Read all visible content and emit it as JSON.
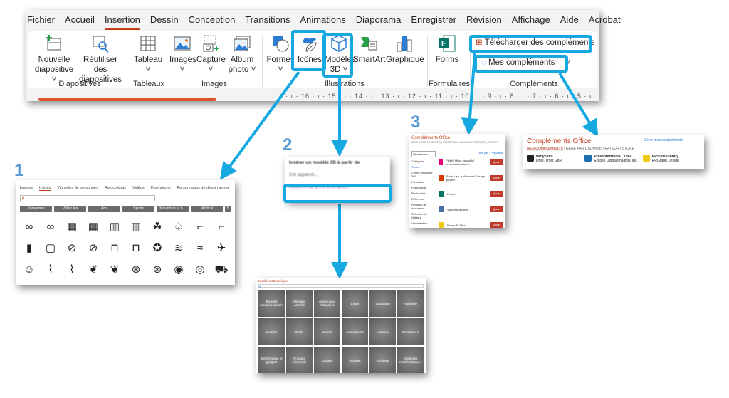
{
  "ribbon": {
    "tabs": [
      "Fichier",
      "Accueil",
      "Insertion",
      "Dessin",
      "Conception",
      "Transitions",
      "Animations",
      "Diaporama",
      "Enregistrer",
      "Révision",
      "Affichage",
      "Aide",
      "Acrobat"
    ],
    "active_tab": "Insertion",
    "buttons": {
      "nouvelle": "Nouvelle diapositive ˅",
      "reutiliser": "Réutiliser des diapositives",
      "tableau": "Tableau ˅",
      "images": "Images ˅",
      "capture": "Capture ˅",
      "album": "Album photo ˅",
      "formes": "Formes ˅",
      "icones": "Icônes",
      "modeles": "Modèles 3D ˅",
      "smartart": "SmartArt",
      "graphique": "Graphique",
      "forms": "Forms",
      "telecharger": "Télécharger des compléments",
      "mes": "Mes compléments",
      "mes_chevron": "˅"
    },
    "groups": [
      "Diapositives",
      "Tableaux",
      "Images",
      "Illustrations",
      "Formulaires",
      "Compléments"
    ],
    "ruler": "· ı · 16 · ı · 15 · ı · 14 · ı · 13 · ı · 12 · ı · 11 · ı · 10 · ı · 9 · ı · 8 · ı · 7 · ı · 6 · ı · 5 · ı"
  },
  "accent": "#16a9e1",
  "steps": [
    "1",
    "2",
    "3"
  ],
  "icons_panel": {
    "tabs": [
      "Images",
      "Icônes",
      "Vignettes de personnes",
      "Autocollants",
      "Vidéos",
      "Illustrations",
      "Personnages de dessin animé"
    ],
    "active_tab": "Icônes",
    "search_icon": "ρ",
    "categories": [
      "Personnes",
      "Véhicules",
      "Arts",
      "Sports",
      "Nourriture et b...",
      "Médical",
      "S"
    ],
    "icons": [
      "∞",
      "∞",
      "▦",
      "▦",
      "▥",
      "▥",
      "☘",
      "♤",
      "⌐",
      "⌐",
      "▮",
      "▢",
      "⊘",
      "⊘",
      "⊓",
      "⊓",
      "✪",
      "≋",
      "≈",
      "✈",
      "☺",
      "⌇",
      "⌇",
      "❦",
      "❦",
      "⊛",
      "⊛",
      "◉",
      "◎",
      "⛟"
    ]
  },
  "models_menu": {
    "items": [
      "Insérer un modèle 3D à partir de",
      "Cet appareil...",
      "Modèles 3D prêts à l'emploi..."
    ]
  },
  "store_panel": {
    "title": "Compléments Office",
    "tabs": "MES COMPLÉMENTS | GÉRÉ PAR L'ADMINISTRATEUR | STORE",
    "search": "Rechercher",
    "sort": "Trier par : Popularité",
    "categories_title": "Catégorie",
    "categories": [
      "Toutes",
      "Centre Microsoft 365",
      "Formation",
      "Productivité",
      "Recherche",
      "Référence",
      "Révision de document",
      "Sélection de l'éditeur",
      "Visualisation"
    ],
    "items": [
      "Pickit | Make impactful presentations in m...",
      "Script Lab, a Microsoft Garage project",
      "Forms",
      "Visionneuse web",
      "Power BI Tiles"
    ],
    "add_label": "Ajouter"
  },
  "my_addins": {
    "title": "Compléments Office",
    "manage": "Gérer mes compléments",
    "tabs": [
      "MES COMPLÉMENTS",
      "GÉRÉ PAR L'ADMINISTRATEUR",
      "STORE"
    ],
    "items": [
      {
        "name": "babyplots",
        "publisher": "Dres. Trost GbR"
      },
      {
        "name": "PresenterMedia | Thea...",
        "publisher": "Eclipse Digital Imaging, Inc."
      },
      {
        "name": "RRSlide Library",
        "publisher": "RRGraph Design"
      }
    ]
  },
  "models_panel": {
    "title": "Modèles 3D en ligne",
    "tiles": [
      "Tous les modèles animés",
      "Animaux animés",
      "Animé pour l'éducation",
      "Emoji",
      "Éducation",
      "Anatomie",
      "Mobilier",
      "Outils",
      "Jouets",
      "Autocollants",
      "Animaux",
      "Dinosaures",
      "Électronique et gadgets",
      "Produits Microsoft",
      "Espace",
      "Biologie",
      "Géologie",
      "Symboles mathématiques"
    ]
  }
}
